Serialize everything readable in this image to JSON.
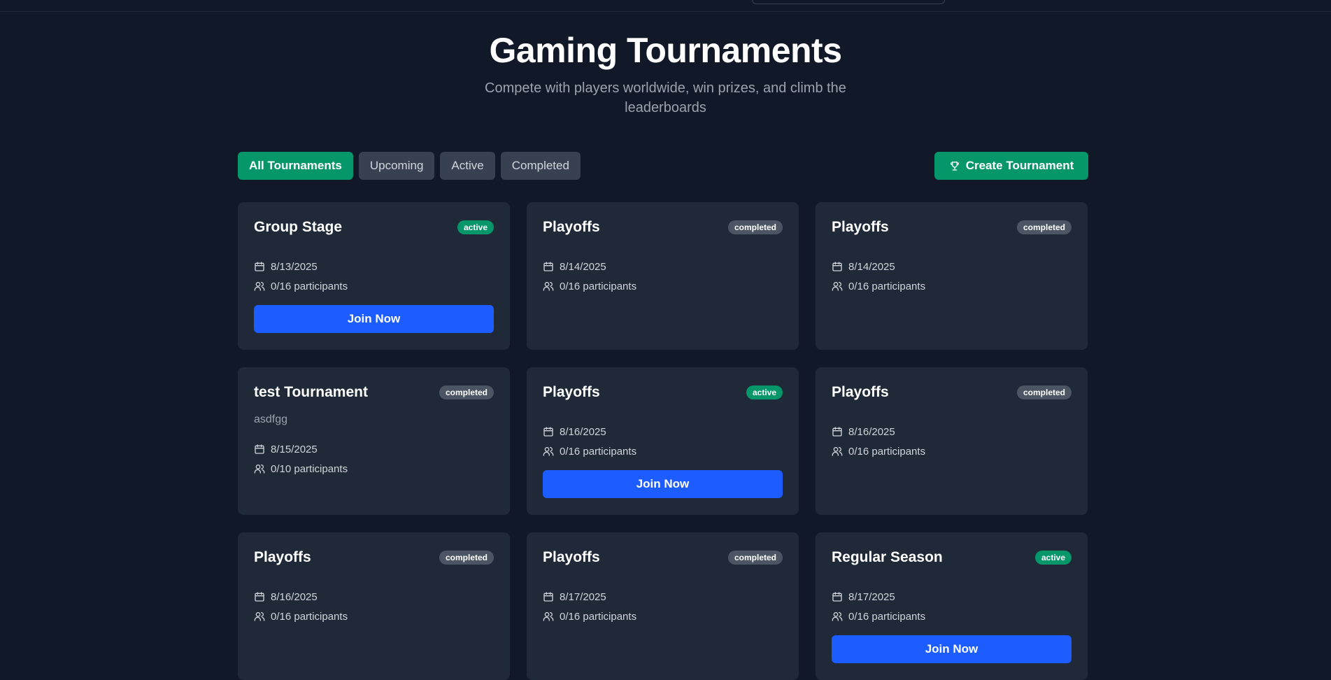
{
  "hero": {
    "title": "Gaming Tournaments",
    "subtitle": "Compete with players worldwide, win prizes, and climb the leaderboards"
  },
  "filters": [
    "All Tournaments",
    "Upcoming",
    "Active",
    "Completed"
  ],
  "create_label": "Create Tournament",
  "join_label": "Join Now",
  "cards": [
    {
      "title": "Group Stage",
      "status": "active",
      "date": "8/13/2025",
      "participants": "0/16 participants"
    },
    {
      "title": "Playoffs",
      "status": "completed",
      "date": "8/14/2025",
      "participants": "0/16 participants"
    },
    {
      "title": "Playoffs",
      "status": "completed",
      "date": "8/14/2025",
      "participants": "0/16 participants"
    },
    {
      "title": "test Tournament",
      "status": "completed",
      "description": "asdfgg",
      "date": "8/15/2025",
      "participants": "0/10 participants"
    },
    {
      "title": "Playoffs",
      "status": "active",
      "date": "8/16/2025",
      "participants": "0/16 participants"
    },
    {
      "title": "Playoffs",
      "status": "completed",
      "date": "8/16/2025",
      "participants": "0/16 participants"
    },
    {
      "title": "Playoffs",
      "status": "completed",
      "date": "8/16/2025",
      "participants": "0/16 participants"
    },
    {
      "title": "Playoffs",
      "status": "completed",
      "date": "8/17/2025",
      "participants": "0/16 participants"
    },
    {
      "title": "Regular Season",
      "status": "active",
      "date": "8/17/2025",
      "participants": "0/16 participants"
    }
  ],
  "colors": {
    "background": "#111827",
    "card": "#1f2937",
    "accent_green": "#059669",
    "join_blue": "#1d5cff",
    "badge_gray": "#4b5563"
  },
  "icons": {
    "date": "calendar-icon",
    "participants": "users-icon",
    "create": "trophy-icon"
  }
}
